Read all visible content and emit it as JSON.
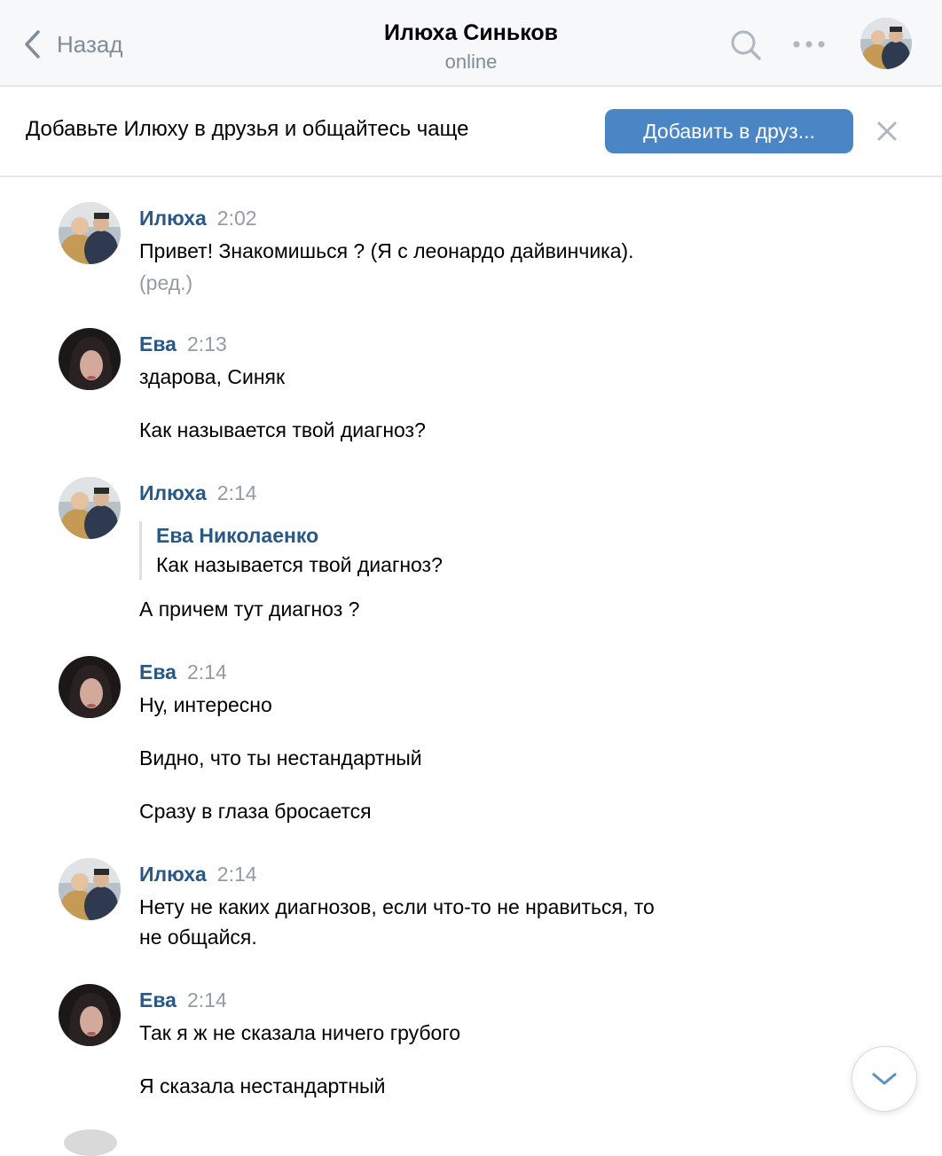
{
  "header": {
    "back_label": "Назад",
    "title": "Илюха Синьков",
    "status": "online",
    "back_icon": "chevron-left-icon",
    "search_icon": "search-icon",
    "more_icon": "more-icon"
  },
  "friend_banner": {
    "text": "Добавьте Илюху в друзья и общайтесь чаще",
    "button_label": "Добавить в друз...",
    "close_icon": "close-icon",
    "button_color": "#4a86c5"
  },
  "messages": [
    {
      "author": "Илюха",
      "time": "2:02",
      "lines": [
        "Привет! Знакомишься ? (Я с леонардо дайвинчика)."
      ],
      "edited": "(ред.)"
    },
    {
      "author": "Ева",
      "time": "2:13",
      "lines": [
        "здарова, Синяк",
        "Как называется твой диагноз?"
      ]
    },
    {
      "author": "Илюха",
      "time": "2:14",
      "reply": {
        "author": "Ева Николаенко",
        "text": "Как называется твой диагноз?"
      },
      "lines": [
        "А причем тут диагноз ?"
      ]
    },
    {
      "author": "Ева",
      "time": "2:14",
      "lines": [
        "Ну, интересно",
        "Видно, что ты нестандартный",
        "Сразу в глаза бросается"
      ]
    },
    {
      "author": "Илюха",
      "time": "2:14",
      "lines": [
        "Нету не каких диагнозов, если что-то не нравиться, то",
        "не общайся."
      ]
    },
    {
      "author": "Ева",
      "time": "2:14",
      "lines": [
        "Так я ж не сказала ничего грубого",
        "Я сказала нестандартный"
      ]
    }
  ],
  "scroll_down_icon": "chevron-down-icon",
  "colors": {
    "author": "#2a5885",
    "meta": "#939ba5",
    "header_bg": "#f7f8fa"
  }
}
